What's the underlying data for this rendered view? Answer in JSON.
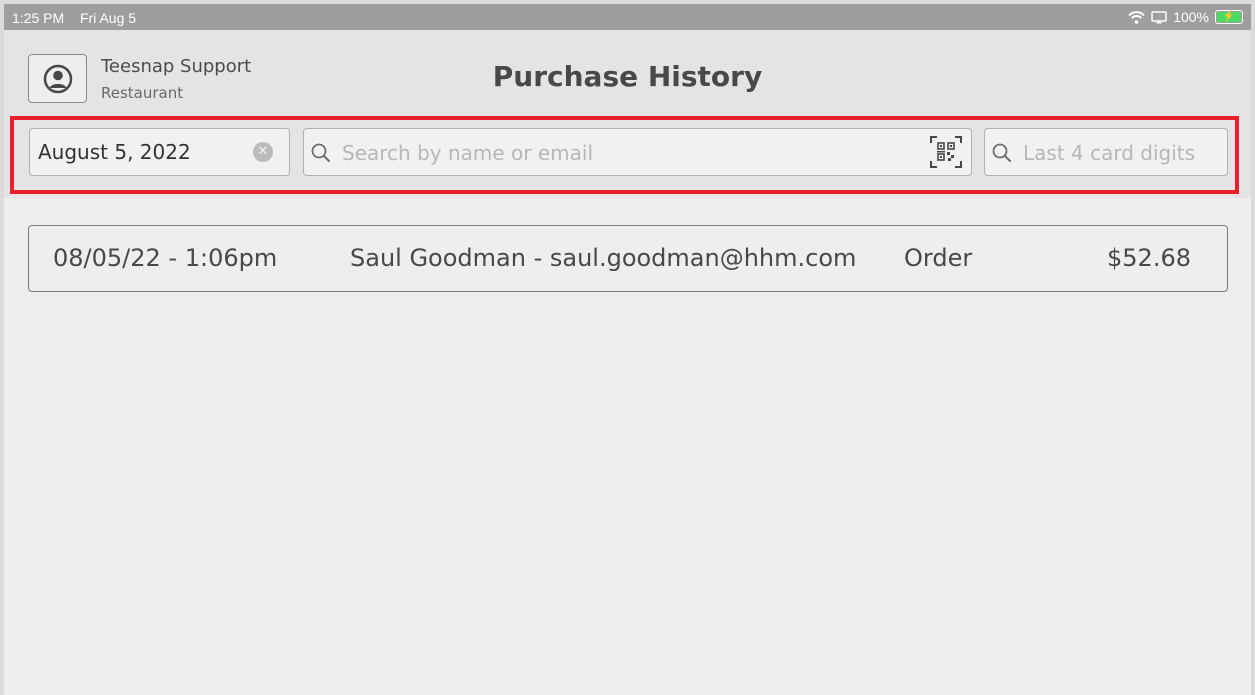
{
  "status_bar": {
    "time": "1:25 PM",
    "date": "Fri Aug 5",
    "battery": "100%",
    "icons": [
      "wifi-icon",
      "screen-mirror-icon",
      "battery-charging-icon"
    ]
  },
  "header": {
    "user_name": "Teesnap Support",
    "user_role": "Restaurant",
    "title": "Purchase History"
  },
  "filters": {
    "date_value": "August 5, 2022",
    "search_placeholder": "Search by name or email",
    "search_value": "",
    "card_placeholder": "Last 4 card digits",
    "card_value": ""
  },
  "purchases": [
    {
      "datetime": "08/05/22 - 1:06pm",
      "customer": "Saul Goodman - saul.goodman@hhm.com",
      "type": "Order",
      "amount": "$52.68"
    }
  ],
  "colors": {
    "highlight": "#e8202a",
    "battery": "#4cd964"
  }
}
